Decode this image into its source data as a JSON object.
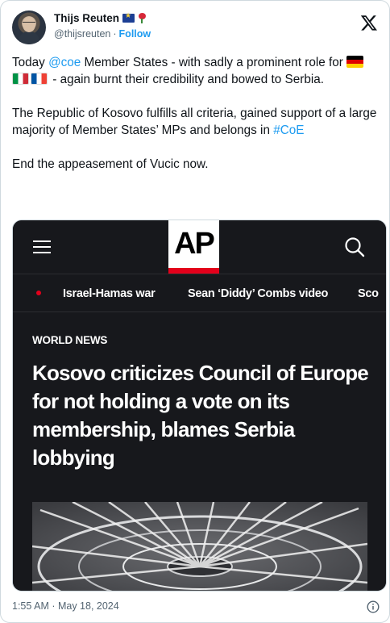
{
  "author": {
    "display_name": "Thijs Reuten",
    "handle": "@thijsreuten",
    "separator": "·",
    "follow_label": "Follow",
    "badges": [
      "eu-flag-icon",
      "rose-icon"
    ]
  },
  "tweet": {
    "line1_prefix": "Today ",
    "mention": "@coe",
    "line1_suffix": " Member States - with sadly a prominent role for ",
    "flags": [
      "de-flag-icon",
      "it-flag-icon",
      "fr-flag-icon"
    ],
    "line1_end": " - again burnt their credibility and bowed to Serbia.",
    "paragraph2_text": "The Republic of Kosovo fulfills all criteria, gained support of a large majority of Member States’ MPs and belongs in ",
    "hashtag": "#CoE",
    "paragraph3": "End the appeasement of Vucic now."
  },
  "card": {
    "logo_text": "AP",
    "nav_items": [
      "Israel-Hamas war",
      "Sean ‘Diddy’ Combs video",
      "Sco"
    ],
    "section_label": "WORLD NEWS",
    "headline": "Kosovo criticizes Council of Europe for not holding a vote on its membership, blames Serbia lobbying"
  },
  "footer": {
    "timestamp": "1:55 AM · May 18, 2024"
  },
  "colors": {
    "link": "#1d9bf0",
    "ap_red": "#e3001b",
    "ap_background": "#17181c"
  }
}
